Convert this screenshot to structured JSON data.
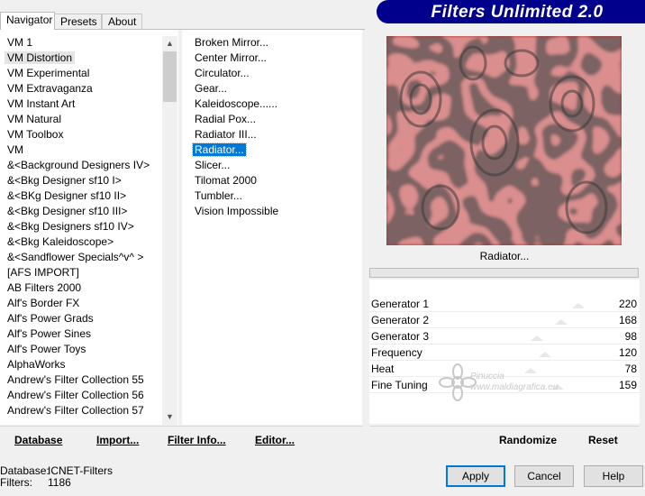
{
  "app": {
    "title": "Filters Unlimited 2.0"
  },
  "tabs": [
    {
      "label": "Navigator",
      "active": true
    },
    {
      "label": "Presets",
      "active": false
    },
    {
      "label": "About",
      "active": false
    }
  ],
  "categories": [
    "VM 1",
    "VM Distortion",
    "VM Experimental",
    "VM Extravaganza",
    "VM Instant Art",
    "VM Natural",
    "VM Toolbox",
    "VM",
    "&<Background Designers IV>",
    "&<Bkg Designer sf10 I>",
    "&<BKg Designer sf10 II>",
    "&<Bkg Designer sf10 III>",
    "&<Bkg Designers sf10 IV>",
    "&<Bkg Kaleidoscope>",
    "&<Sandflower Specials^v^ >",
    "[AFS IMPORT]",
    "AB Filters 2000",
    "Alf's Border FX",
    "Alf's Power Grads",
    "Alf's Power Sines",
    "Alf's Power Toys",
    "AlphaWorks",
    "Andrew's Filter Collection 55",
    "Andrew's Filter Collection 56",
    "Andrew's Filter Collection 57"
  ],
  "selected_category": "VM Distortion",
  "filters": [
    "Broken Mirror...",
    "Center Mirror...",
    "Circulator...",
    "Gear...",
    "Kaleidoscope......",
    "Radial Pox...",
    "Radiator III...",
    "Radiator...",
    "Slicer...",
    "Tilomat 2000",
    "Tumbler...",
    "Vision Impossible"
  ],
  "selected_filter": "Radiator...",
  "preview": {
    "name": "Radiator..."
  },
  "params": [
    {
      "label": "Generator 1",
      "value": "220",
      "level": 0.86
    },
    {
      "label": "Generator 2",
      "value": "168",
      "level": 0.66
    },
    {
      "label": "Generator 3",
      "value": "98",
      "level": 0.38
    },
    {
      "label": "Frequency",
      "value": "120",
      "level": 0.47
    },
    {
      "label": "Heat",
      "value": "78",
      "level": 0.31
    },
    {
      "label": "Fine Tuning",
      "value": "159",
      "level": 0.62
    }
  ],
  "toolbar": {
    "database": "Database",
    "import": "Import...",
    "filter_info": "Filter Info...",
    "editor": "Editor..."
  },
  "right_toolbar": {
    "randomize": "Randomize",
    "reset": "Reset"
  },
  "status": {
    "database_label": "Database:",
    "database_value": "ICNET-Filters",
    "filters_label": "Filters:",
    "filters_value": "1186"
  },
  "buttons": {
    "apply": "Apply",
    "cancel": "Cancel",
    "help": "Help"
  },
  "watermark": {
    "line1": "Pinuccia",
    "line2": "www.maldiagrafica.eu"
  },
  "colors": {
    "banner": "#00008c",
    "preview_red": "#b8261f",
    "preview_dark": "#3a3a3a",
    "selection": "#0078d7"
  }
}
